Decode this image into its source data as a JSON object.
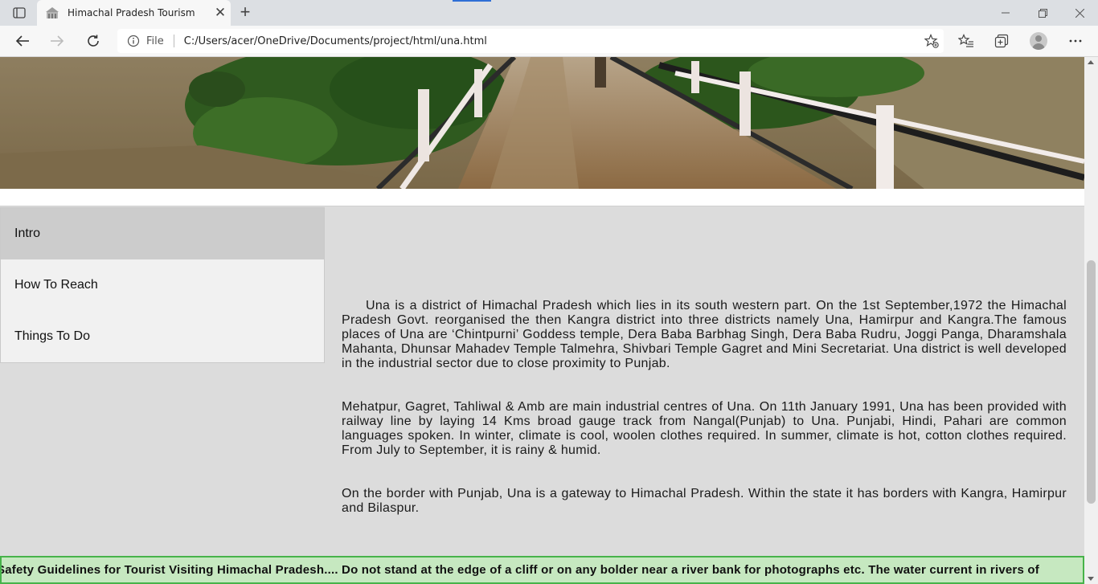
{
  "browser": {
    "tab_title": "Himachal Pradesh Tourism",
    "address_prefix": "File",
    "url": "C:/Users/acer/OneDrive/Documents/project/html/una.html",
    "accent": "#2f6fd6"
  },
  "hero": {
    "alt": "Wooden suspension bridge over a river with green trees"
  },
  "sidenav": {
    "items": [
      {
        "label": "Intro",
        "active": true
      },
      {
        "label": "How To Reach",
        "active": false
      },
      {
        "label": "Things To Do",
        "active": false
      }
    ]
  },
  "content": {
    "paragraphs": [
      "Una is a district of Himachal Pradesh which lies in its south western part. On the 1st September,1972 the Himachal Pradesh Govt. reorganised the then Kangra district into three districts namely Una, Hamirpur and Kangra.The famous places of Una are ‘Chintpurni’ Goddess temple, Dera Baba Barbhag Singh, Dera Baba Rudru, Joggi Panga, Dharamshala Mahanta, Dhunsar Mahadev Temple Talmehra, Shivbari Temple Gagret and Mini Secretariat. Una district is well developed in the industrial sector due to close proximity to Punjab.",
      "Mehatpur, Gagret, Tahliwal & Amb are main industrial centres of Una. On 11th January 1991, Una has been provided with railway line by laying 14 Kms broad gauge track from Nangal(Punjab) to Una. Punjabi, Hindi, Pahari are common languages spoken. In winter, climate is cool, woolen clothes required. In summer, climate is hot, cotton clothes required. From July to September, it is rainy & humid.",
      "On the border with Punjab, Una is a gateway to Himachal Pradesh. Within the state it has borders with Kangra, Hamirpur and Bilaspur."
    ]
  },
  "marquee": {
    "text": "Safety Guidelines for Tourist Visiting Himachal Pradesh.... Do not stand at the edge of a cliff or on any bolder near a river bank for photographs etc. The water current in rivers of",
    "background": "#c6e8c0",
    "border": "#47b34a"
  }
}
